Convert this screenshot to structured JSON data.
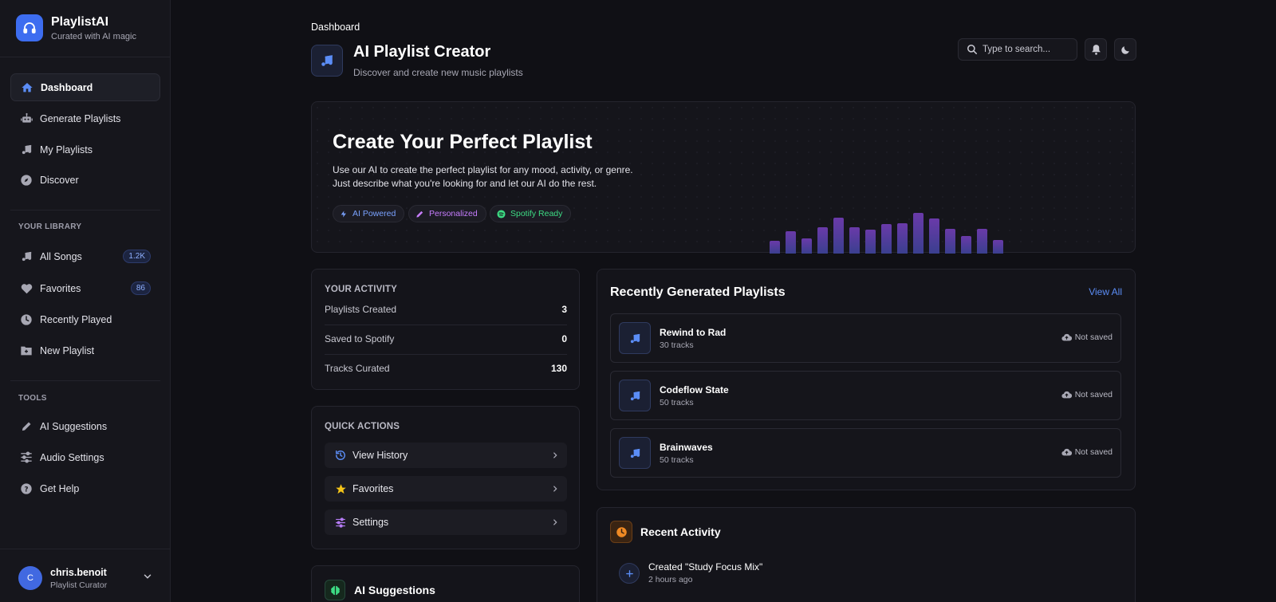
{
  "brand": {
    "name": "PlaylistAI",
    "tagline": "Curated with AI magic"
  },
  "nav": {
    "main": [
      {
        "label": "Dashboard",
        "icon": "home-icon",
        "active": true
      },
      {
        "label": "Generate Playlists",
        "icon": "robot-icon"
      },
      {
        "label": "My Playlists",
        "icon": "music-note-icon"
      },
      {
        "label": "Discover",
        "icon": "compass-icon"
      }
    ],
    "library_heading": "YOUR LIBRARY",
    "library": [
      {
        "label": "All Songs",
        "icon": "music-note-icon",
        "badge": "1.2K"
      },
      {
        "label": "Favorites",
        "icon": "heart-icon",
        "badge": "86"
      },
      {
        "label": "Recently Played",
        "icon": "clock-icon"
      },
      {
        "label": "New Playlist",
        "icon": "folder-plus-icon"
      }
    ],
    "tools_heading": "TOOLS",
    "tools": [
      {
        "label": "AI Suggestions",
        "icon": "pencil-icon"
      },
      {
        "label": "Audio Settings",
        "icon": "sliders-icon"
      },
      {
        "label": "Get Help",
        "icon": "help-icon"
      }
    ]
  },
  "user": {
    "initial": "C",
    "name": "chris.benoit",
    "role": "Playlist Curator"
  },
  "header": {
    "breadcrumb": "Dashboard",
    "title": "AI Playlist Creator",
    "subtitle": "Discover and create new music playlists",
    "search_placeholder": "Type to search..."
  },
  "hero": {
    "title": "Create Your Perfect Playlist",
    "line1": "Use our AI to create the perfect playlist for any mood, activity, or genre.",
    "line2": "Just describe what you're looking for and let our AI do the rest.",
    "chips": [
      {
        "label": "AI Powered",
        "icon": "bolt-icon",
        "color": "#7aa2ff"
      },
      {
        "label": "Personalized",
        "icon": "pencil-icon",
        "color": "#c77dff"
      },
      {
        "label": "Spotify Ready",
        "icon": "spotify-icon",
        "color": "#3ddc84"
      }
    ]
  },
  "activity": {
    "heading": "YOUR ACTIVITY",
    "stats": [
      {
        "label": "Playlists Created",
        "value": "3"
      },
      {
        "label": "Saved to Spotify",
        "value": "0"
      },
      {
        "label": "Tracks Curated",
        "value": "130"
      }
    ]
  },
  "quick_actions": {
    "heading": "QUICK ACTIONS",
    "items": [
      {
        "label": "View History",
        "icon": "history-icon",
        "color": "#5b8df6"
      },
      {
        "label": "Favorites",
        "icon": "star-icon",
        "color": "#f5c518"
      },
      {
        "label": "Settings",
        "icon": "sliders-icon",
        "color": "#b57cf5"
      }
    ]
  },
  "ai_suggestions": {
    "title": "AI Suggestions"
  },
  "recent_playlists": {
    "title": "Recently Generated Playlists",
    "view_all": "View All",
    "items": [
      {
        "name": "Rewind to Rad",
        "tracks": "30 tracks",
        "status": "Not saved"
      },
      {
        "name": "Codeflow State",
        "tracks": "50 tracks",
        "status": "Not saved"
      },
      {
        "name": "Brainwaves",
        "tracks": "50 tracks",
        "status": "Not saved"
      }
    ]
  },
  "recent_activity": {
    "title": "Recent Activity",
    "items": [
      {
        "text": "Created \"Study Focus Mix\"",
        "time": "2 hours ago"
      }
    ]
  },
  "colors": {
    "accent": "#3d6df0",
    "link": "#5b8df6",
    "activity": "#f08a24"
  }
}
